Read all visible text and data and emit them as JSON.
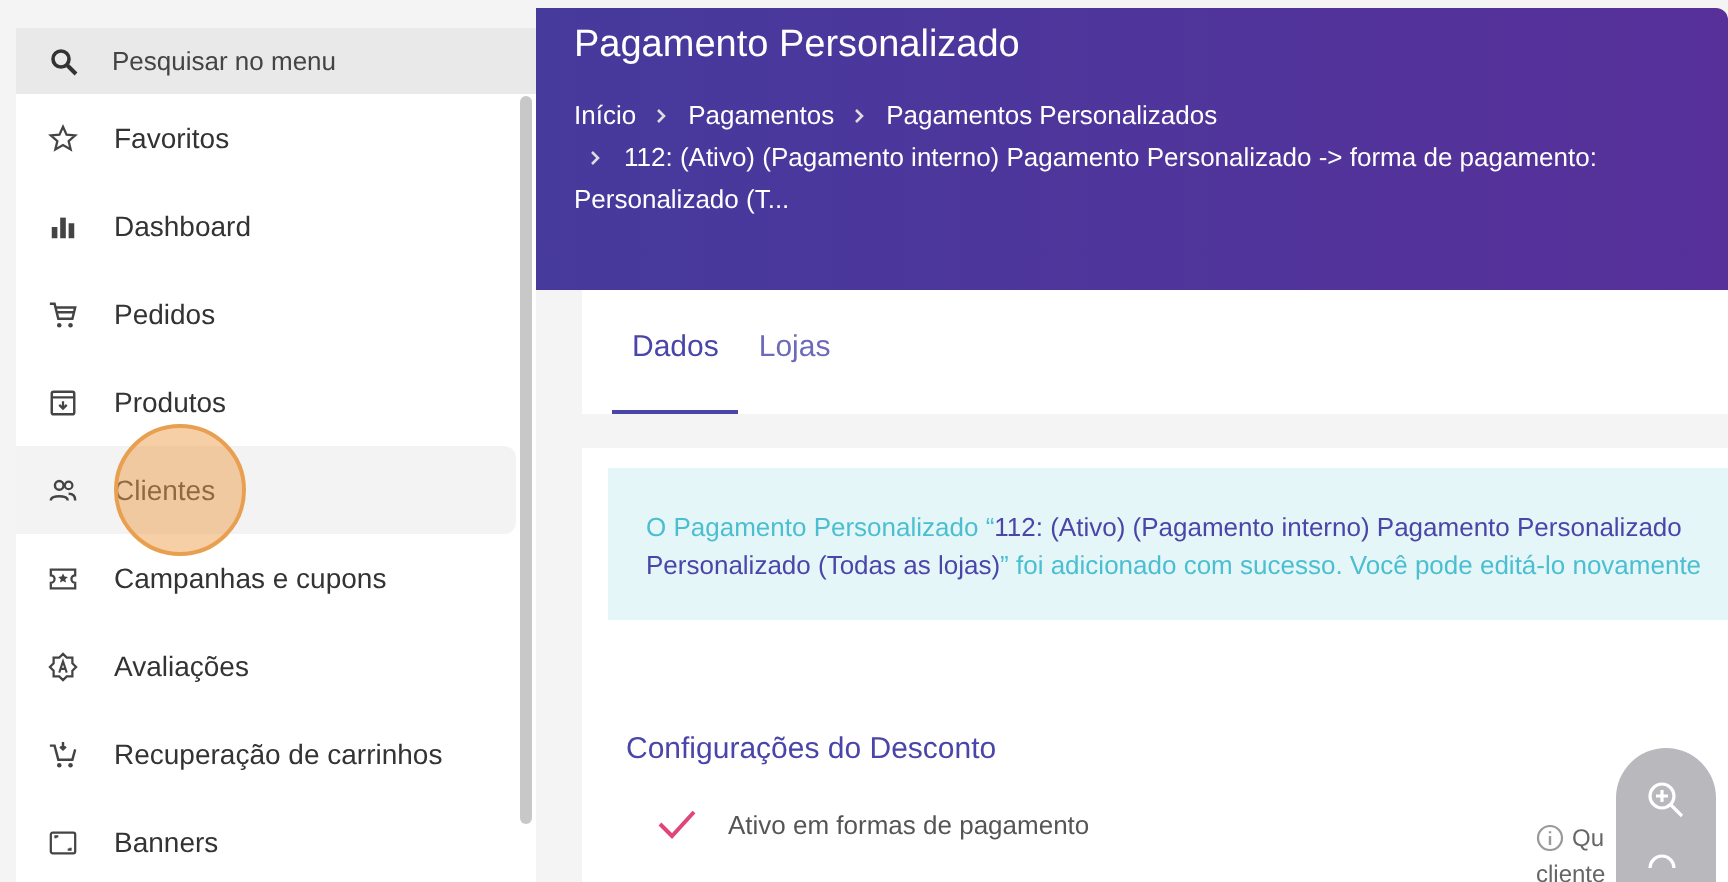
{
  "sidebar": {
    "search": {
      "placeholder": "Pesquisar no menu"
    },
    "items": [
      {
        "label": "Favoritos",
        "selected": false
      },
      {
        "label": "Dashboard",
        "selected": false
      },
      {
        "label": "Pedidos",
        "selected": false
      },
      {
        "label": "Produtos",
        "selected": false
      },
      {
        "label": "Clientes",
        "selected": true
      },
      {
        "label": "Campanhas e cupons",
        "selected": false
      },
      {
        "label": "Avaliações",
        "selected": false
      },
      {
        "label": "Recuperação de carrinhos",
        "selected": false
      },
      {
        "label": "Banners",
        "selected": false
      }
    ]
  },
  "header": {
    "title": "Pagamento Personalizado",
    "breadcrumbs": [
      "Início",
      "Pagamentos",
      "Pagamentos Personalizados",
      "112: (Ativo) (Pagamento interno) Pagamento Personalizado -> forma de pagamento: Personalizado (T..."
    ]
  },
  "tabs": [
    {
      "label": "Dados",
      "selected": true
    },
    {
      "label": "Lojas",
      "selected": false
    }
  ],
  "alert": {
    "lines": [
      "O Pagamento Personalizado “**112: (Ativo) (Pagamento interno) Pagamento Personalizado**",
      "**Personalizado (Todas as lojas)**” foi adicionado com sucesso. Você pode editá-lo novamente"
    ]
  },
  "section": {
    "title": "Configurações do Desconto",
    "options": [
      {
        "label": "Ativo em formas de pagamento",
        "checked": true
      }
    ],
    "hint": [
      "Qu",
      "cliente"
    ]
  }
}
